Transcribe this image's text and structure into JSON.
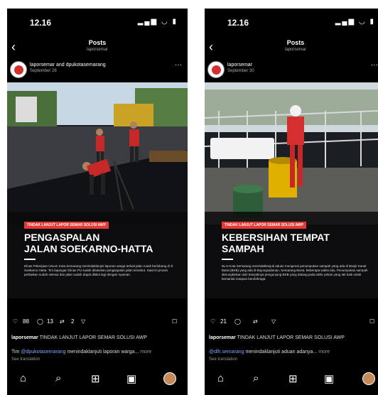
{
  "phones": [
    {
      "status": {
        "time": "12.16",
        "icons": "▂▄▆ ◡ ▮"
      },
      "nav": {
        "title": "Posts",
        "subtitle": "laporsemar",
        "back": "‹"
      },
      "post": {
        "author": "laporsemar and dpukotasemarang",
        "date": "September 28",
        "more": "···",
        "image": {
          "label": "TINDAK LANJUT LAPOR SEMAR SOLUSI AWP",
          "headline_1": "PENGASPALAN",
          "headline_2": "JALAN SOEKARNO-HATTA",
          "body": "Dinas Pekerjaan Umum Kota Semarang menindaklanjuti laporan warga terkait jalan rusak berlubang di Jl Soekarno Hatta. Tim lapangan Dinas PU sudah dilakukan pengaspalan jalan tersebut. Saat ini proses perbaikan sudah selesai dan jalan sudah dapat dilalui lagi dengan nyaman."
        },
        "actions": {
          "likes": "88",
          "comments": "13",
          "reposts": "2"
        },
        "caption_user": "laporsemar",
        "caption_text": "TINDAK LANJUT LAPOR SEMAR SOLUSI AWP",
        "comment_prefix": "Tim ",
        "comment_mention": "@dpukotasemarang",
        "comment_text": " menindaklanjuti laporan warga...",
        "comment_more": " more",
        "see_translation": "See translation"
      }
    },
    {
      "status": {
        "time": "12.16",
        "icons": "▂▄▆ ◡ ▮"
      },
      "nav": {
        "title": "Posts",
        "subtitle": "laporsemar",
        "back": "‹"
      },
      "post": {
        "author": "laporsemar",
        "date": "September 30",
        "more": "···",
        "image": {
          "label": "TINDAK LANJUT LAPOR SEMAR SOLUSI AWP",
          "headline_1": "KEBERSIHAN TEMPAT",
          "headline_2": "SAMPAH",
          "body": "DLH Kota Semarang menindaklanjuti aduan mengenai penumpukan sampah yang ada di Banjir Kanal Barat (BKB) yang ada di Bojongsalaman, Semarang Barat. Beberapa waktu lalu, Penumpukan sampah dimungkinkan dari banyaknya pengunjung BKB yang datang pada akhir pekan yang tak baik untuk bersantai maupun berolahraga."
        },
        "actions": {
          "likes": "21",
          "comments": "",
          "reposts": ""
        },
        "caption_user": "laporsemar",
        "caption_text": "TINDAK LANJUT LAPOR SEMAR SOLUSI AWP",
        "comment_prefix": "",
        "comment_mention": "@dlh.semarang",
        "comment_text": " menindaklanjuti aduan adanya...",
        "comment_more": " more",
        "see_translation": "See translation"
      }
    }
  ],
  "tabbar": {
    "home": "⌂",
    "search": "⌕",
    "create": "⊞",
    "reels": "▣"
  },
  "icons": {
    "heart": "♡",
    "comment": "◯",
    "repost": "⇄",
    "share": "▽",
    "save": "☐"
  },
  "colors": {
    "label_red": "#e53935",
    "mention": "#7fa8ff"
  }
}
